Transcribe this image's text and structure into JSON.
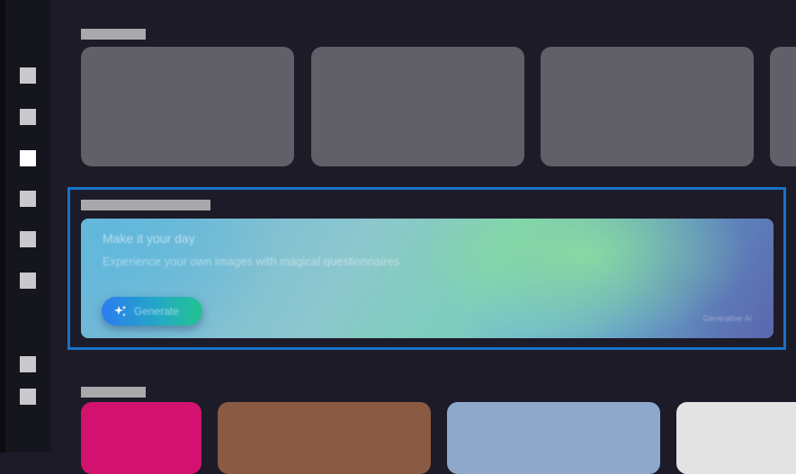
{
  "sidebar": {
    "items": [
      {
        "id": "nav-1",
        "active": false
      },
      {
        "id": "nav-2",
        "active": false
      },
      {
        "id": "nav-3",
        "active": true
      },
      {
        "id": "nav-4",
        "active": false
      },
      {
        "id": "nav-5",
        "active": false
      },
      {
        "id": "nav-6",
        "active": false
      },
      {
        "id": "nav-7",
        "active": false
      },
      {
        "id": "nav-8",
        "active": false
      }
    ]
  },
  "banner": {
    "title": "Make it your day",
    "subtitle": "Experience your own images with magical questionnaires",
    "generate_label": "Generate",
    "footnote": "Generative AI"
  },
  "bottom_row": {
    "card_colors": [
      "#d2126e",
      "#8a5a42",
      "#8ea8cc",
      "#e3e3e3"
    ]
  },
  "colors": {
    "background": "#1d1b28",
    "placeholder_card": "#616068",
    "focus_ring": "#1873c7"
  }
}
